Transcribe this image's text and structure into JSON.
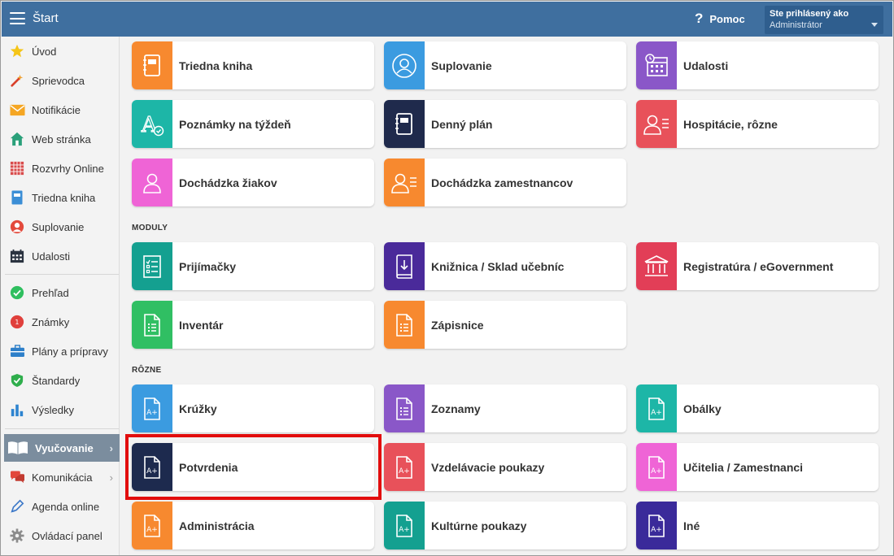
{
  "header": {
    "title": "Štart",
    "help_label": "Pomoc",
    "help_symbol": "?",
    "user_line1": "Ste prihlásený ako",
    "user_line2": "Administrátor"
  },
  "sidebar": {
    "items": [
      {
        "label": "Úvod",
        "icon": "star-icon"
      },
      {
        "label": "Sprievodca",
        "icon": "magic-wand-icon"
      },
      {
        "label": "Notifikácie",
        "icon": "envelope-icon"
      },
      {
        "label": "Web stránka",
        "icon": "home-icon"
      },
      {
        "label": "Rozvrhy Online",
        "icon": "timetable-grid-icon"
      },
      {
        "label": "Triedna kniha",
        "icon": "class-book-icon"
      },
      {
        "label": "Suplovanie",
        "icon": "person-icon"
      },
      {
        "label": "Udalosti",
        "icon": "calendar-icon"
      },
      {
        "label": "Prehľad",
        "icon": "check-circle-icon"
      },
      {
        "label": "Známky",
        "icon": "grades-icon"
      },
      {
        "label": "Plány a prípravy",
        "icon": "briefcase-icon"
      },
      {
        "label": "Štandardy",
        "icon": "shield-check-icon"
      },
      {
        "label": "Výsledky",
        "icon": "bar-chart-icon"
      },
      {
        "label": "Vyučovanie",
        "icon": "open-book-icon"
      },
      {
        "label": "Komunikácia",
        "icon": "chat-bubbles-icon"
      },
      {
        "label": "Agenda online",
        "icon": "pen-icon"
      },
      {
        "label": "Ovládací panel",
        "icon": "gear-icon"
      }
    ]
  },
  "sections": {
    "moduly": "MODULY",
    "rozne": "RÔZNE"
  },
  "tiles": {
    "triedna_kniha": "Triedna kniha",
    "suplovanie": "Suplovanie",
    "udalosti": "Udalosti",
    "poznamky": "Poznámky na týždeň",
    "denny_plan": "Denný plán",
    "hospitacie": "Hospitácie, rôzne",
    "dochadzka_ziakov": "Dochádzka žiakov",
    "dochadzka_zamestnancov": "Dochádzka zamestnancov",
    "prijimacky": "Prijímačky",
    "kniznica": "Knižnica / Sklad učebníc",
    "registratura": "Registratúra / eGovernment",
    "inventar": "Inventár",
    "zapisnice": "Zápisnice",
    "kruzky": "Krúžky",
    "zoznamy": "Zoznamy",
    "obalky": "Obálky",
    "potvrdenia": "Potvrdenia",
    "vzdelavacie": "Vzdelávacie poukazy",
    "ucitelia": "Učitelia / Zamestnanci",
    "administracia": "Administrácia",
    "kulturne": "Kultúrne poukazy",
    "ine": "Iné"
  },
  "doc_icon_text": "A+",
  "colors": {
    "header": "#3f6f9f",
    "highlight": "#e20d0d",
    "orange": "#f7892f",
    "blue": "#3b9be0",
    "purple": "#8a57c8",
    "teal": "#1db6a7",
    "navy": "#1f2a4c",
    "red": "#e8515a",
    "pink": "#ef64d6",
    "dark_teal": "#14a090",
    "indigo": "#4a2a9a",
    "crimson": "#e23e57",
    "green": "#30bf63",
    "dark_navy": "#1d2a4e",
    "deep_indigo": "#3a2a9a"
  }
}
